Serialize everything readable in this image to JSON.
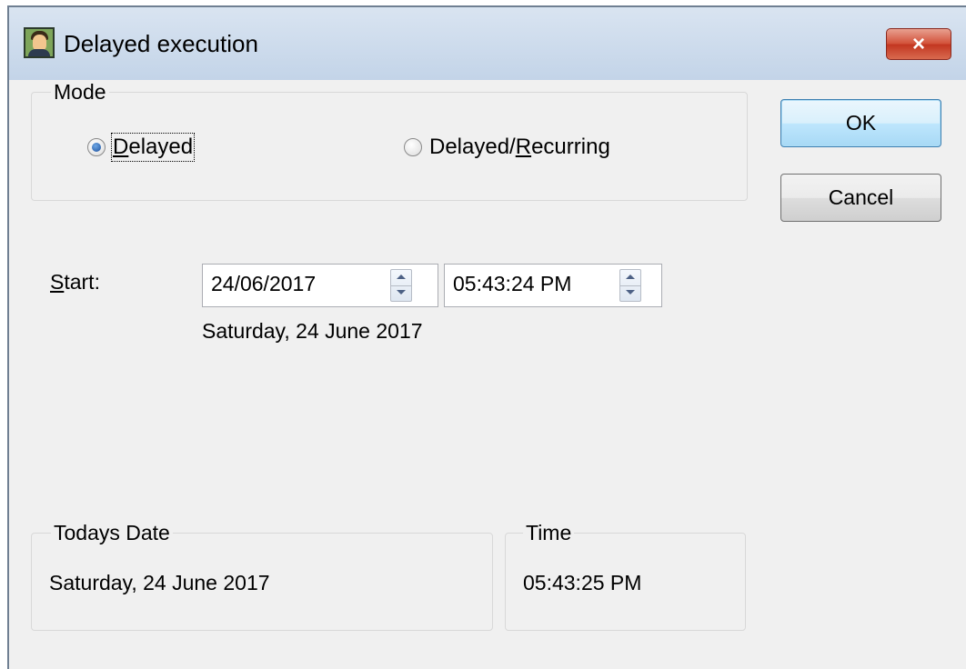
{
  "window": {
    "title": "Delayed execution",
    "app_icon": "user-portrait-icon",
    "close_icon": "close-icon",
    "close_glyph": "×"
  },
  "mode_group": {
    "label": "Mode",
    "options": [
      {
        "label_pre": "",
        "label_key": "D",
        "label_post": "elayed",
        "selected": true
      },
      {
        "label_pre": "Delayed/",
        "label_key": "R",
        "label_post": "ecurring",
        "selected": false
      }
    ]
  },
  "buttons": {
    "ok": "OK",
    "cancel": "Cancel"
  },
  "start": {
    "label_key": "S",
    "label_post": "tart:",
    "date_value": "24/06/2017",
    "time_value": "05:43:24 PM",
    "date_long": "Saturday, 24 June 2017"
  },
  "todays_date_group": {
    "label": "Todays Date",
    "value": "Saturday, 24 June 2017"
  },
  "time_group": {
    "label": "Time",
    "value": "05:43:25 PM"
  },
  "colors": {
    "dialog_bg": "#f0f0f0",
    "titlebar": "#c9d8ea",
    "close_button": "#c94a32",
    "default_button_border": "#3c7fb1"
  }
}
